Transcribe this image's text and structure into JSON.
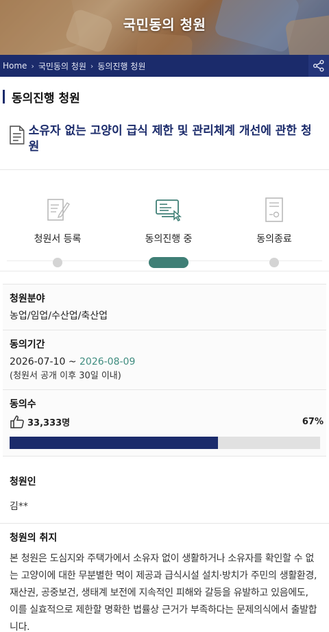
{
  "hero": {
    "title": "국민동의 청원"
  },
  "breadcrumb": {
    "items": [
      "Home",
      "국민동의 청원",
      "동의진행 청원"
    ]
  },
  "section": {
    "title": "동의진행 청원"
  },
  "petition": {
    "title": "소유자 없는 고양이 급식 제한 및 관리체계 개선에 관한 청원"
  },
  "steps": [
    {
      "label": "청원서 등록",
      "icon": "pen-document-icon",
      "state": "done"
    },
    {
      "label": "동의진행 중",
      "icon": "computer-clicking-icon",
      "state": "active"
    },
    {
      "label": "동의종료",
      "icon": "certificate-icon",
      "state": "pending"
    }
  ],
  "info": {
    "field_label": "청원분야",
    "field_value": "농업/임업/수산업/축산업",
    "period_label": "동의기간",
    "period_start": "2026-07-10 ~ ",
    "period_end": "2026-08-09",
    "period_note": "(청원서 공개 이후 30일 이내)",
    "count_label": "동의수",
    "count_value": "33,333명",
    "percent": "67%",
    "progress_fraction": 0.67
  },
  "petitioner": {
    "label": "청원인",
    "name": "김**"
  },
  "purpose": {
    "label": "청원의 취지",
    "text": "본 청원은 도심지와 주택가에서 소유자 없이 생활하거나 소유자를 확인할 수 없는 고양이에 대한 무분별한 먹이 제공과 급식시설 설치·방치가 주민의 생활환경, 재산권, 공중보건, 생태계 보전에 지속적인 피해와 갈등을 유발하고 있음에도, 이를 실효적으로 제한할 명확한 법률상 근거가 부족하다는 문제의식에서 출발합니다."
  },
  "colors": {
    "navy": "#1b2b6b",
    "teal": "#3f7f76",
    "green_text": "#3f8c7f"
  }
}
